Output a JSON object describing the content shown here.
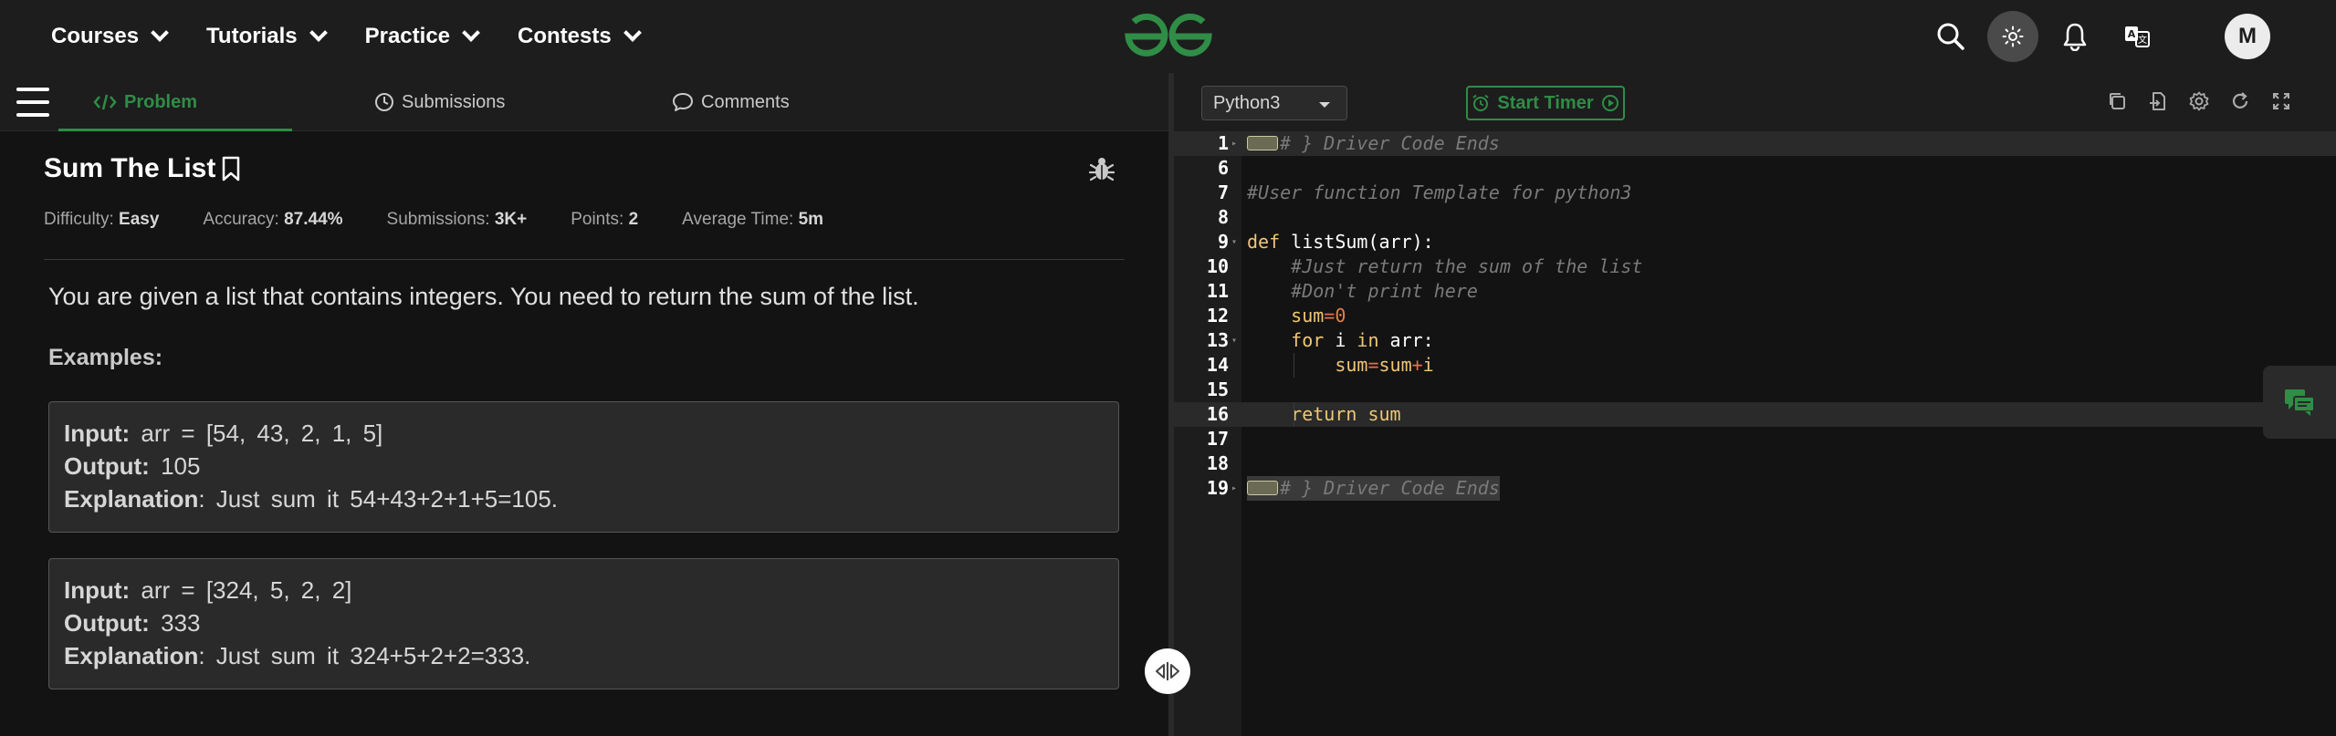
{
  "topnav": {
    "items": [
      {
        "label": "Courses"
      },
      {
        "label": "Tutorials"
      },
      {
        "label": "Practice"
      },
      {
        "label": "Contests"
      }
    ],
    "avatar_initial": "M",
    "brand_color": "#2f8d46"
  },
  "tabs": {
    "problem": "Problem",
    "submissions": "Submissions",
    "comments": "Comments"
  },
  "problem": {
    "title": "Sum The List",
    "difficulty_label": "Difficulty:",
    "difficulty": "Easy",
    "accuracy_label": "Accuracy:",
    "accuracy": "87.44%",
    "submissions_label": "Submissions:",
    "submissions": "3K+",
    "points_label": "Points:",
    "points": "2",
    "avg_time_label": "Average Time:",
    "avg_time": "5m",
    "description": "You are given a list that contains integers. You need to return the sum of the list.",
    "examples_heading": "Examples:",
    "examples": [
      {
        "input_label": "Input:",
        "input": "arr = [54, 43, 2, 1, 5]",
        "output_label": "Output:",
        "output": "105",
        "explanation_label": "Explanation",
        "explanation": ": Just sum it 54+43+2+1+5=105."
      },
      {
        "input_label": "Input:",
        "input": "arr = [324, 5, 2, 2]",
        "output_label": "Output:",
        "output": "333",
        "explanation_label": "Explanation",
        "explanation": ": Just sum it 324+5+2+2=333."
      }
    ]
  },
  "editor": {
    "language": "Python3",
    "timer_label": "Start Timer",
    "lines": [
      {
        "n": "1",
        "text": "# } Driver Code Ends"
      },
      {
        "n": "6",
        "text": ""
      },
      {
        "n": "7",
        "text": "#User function Template for python3"
      },
      {
        "n": "8",
        "text": ""
      },
      {
        "n": "9",
        "def": "def",
        "rest": " listSum(arr):"
      },
      {
        "n": "10",
        "text": "    #Just return the sum of the list"
      },
      {
        "n": "11",
        "text": "    #Don't print here"
      },
      {
        "n": "12",
        "var": "    sum",
        "op": "=",
        "num": "0"
      },
      {
        "n": "13",
        "kw1": "for",
        "mid": " i ",
        "kw2": "in",
        "rest": " arr:"
      },
      {
        "n": "14",
        "a": "sum",
        "op1": "=",
        "b": "sum",
        "op2": "+",
        "c": "i"
      },
      {
        "n": "15",
        "text": ""
      },
      {
        "n": "16",
        "kw": "return",
        "rest": " sum"
      },
      {
        "n": "17",
        "text": ""
      },
      {
        "n": "18",
        "text": ""
      },
      {
        "n": "19",
        "text": "# } Driver Code Ends"
      }
    ]
  }
}
